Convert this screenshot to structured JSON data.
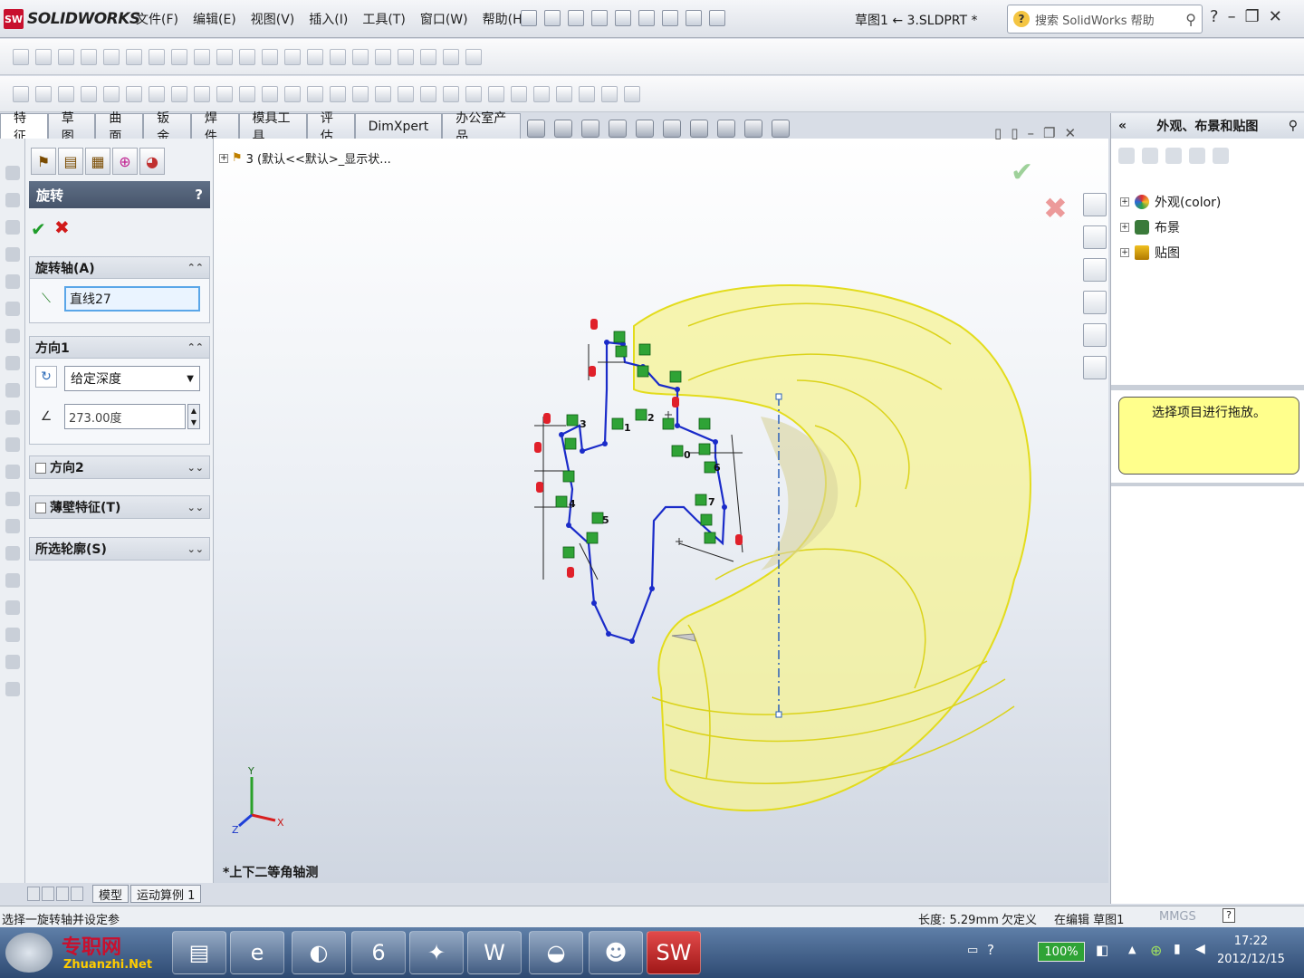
{
  "app": {
    "brand": "SOLIDWORKS",
    "brand_badge": "SW",
    "document_title": "草图1 ← 3.SLDPRT *"
  },
  "menu": [
    "文件(F)",
    "编辑(E)",
    "视图(V)",
    "插入(I)",
    "工具(T)",
    "窗口(W)",
    "帮助(H)"
  ],
  "search": {
    "placeholder": "搜索 SolidWorks 帮助"
  },
  "tabs": [
    "特征",
    "草图",
    "曲面",
    "钣金",
    "焊件",
    "模具工具",
    "评估",
    "DimXpert",
    "办公室产品"
  ],
  "property_manager": {
    "title": "旋转",
    "help": "?",
    "axis_group": {
      "label": "旋转轴(A)",
      "value": "直线27"
    },
    "dir1_group": {
      "label": "方向1",
      "end_condition": "给定深度",
      "angle": "273.00度"
    },
    "dir2_group": {
      "label": "方向2"
    },
    "thin_group": {
      "label": "薄壁特征(T)"
    },
    "contours_group": {
      "label": "所选轮廓(S)"
    }
  },
  "bottom_tabs": [
    "模型",
    "运动算例 1"
  ],
  "graphics": {
    "tree_item": "3  (默认<<默认>_显示状...",
    "view_label": "*上下二等角轴测",
    "triad": {
      "x": "X",
      "y": "Y",
      "z": "Z"
    },
    "sketch_label_1": "1",
    "sketch_label_2": "2",
    "sketch_label_3": "3",
    "sketch_label_4": "4",
    "sketch_label_5": "5",
    "sketch_label_0": "0",
    "sketch_label_6": "6",
    "sketch_label_7": "7"
  },
  "task_pane": {
    "title": "外观、布景和贴图",
    "collapse": "«",
    "items": [
      "外观(color)",
      "布景",
      "贴图"
    ],
    "note": "选择项目进行拖放。"
  },
  "statusbar": {
    "hint": "选择一旋转轴并设定参",
    "length": "长度: 5.29mm",
    "definition": "欠定义",
    "editing": "在编辑 草图1",
    "units": "MMGS"
  },
  "taskbar": {
    "watermark_cn": "专职网",
    "watermark_url": "Zhuanzhi.Net",
    "battery": "100%",
    "time": "17:22",
    "date": "2012/12/15"
  },
  "colors": {
    "model_yellow": "#f4f18a",
    "sketch_blue": "#1a2bc9",
    "accent_green": "#2fa336",
    "header_dark": "#46546a"
  }
}
